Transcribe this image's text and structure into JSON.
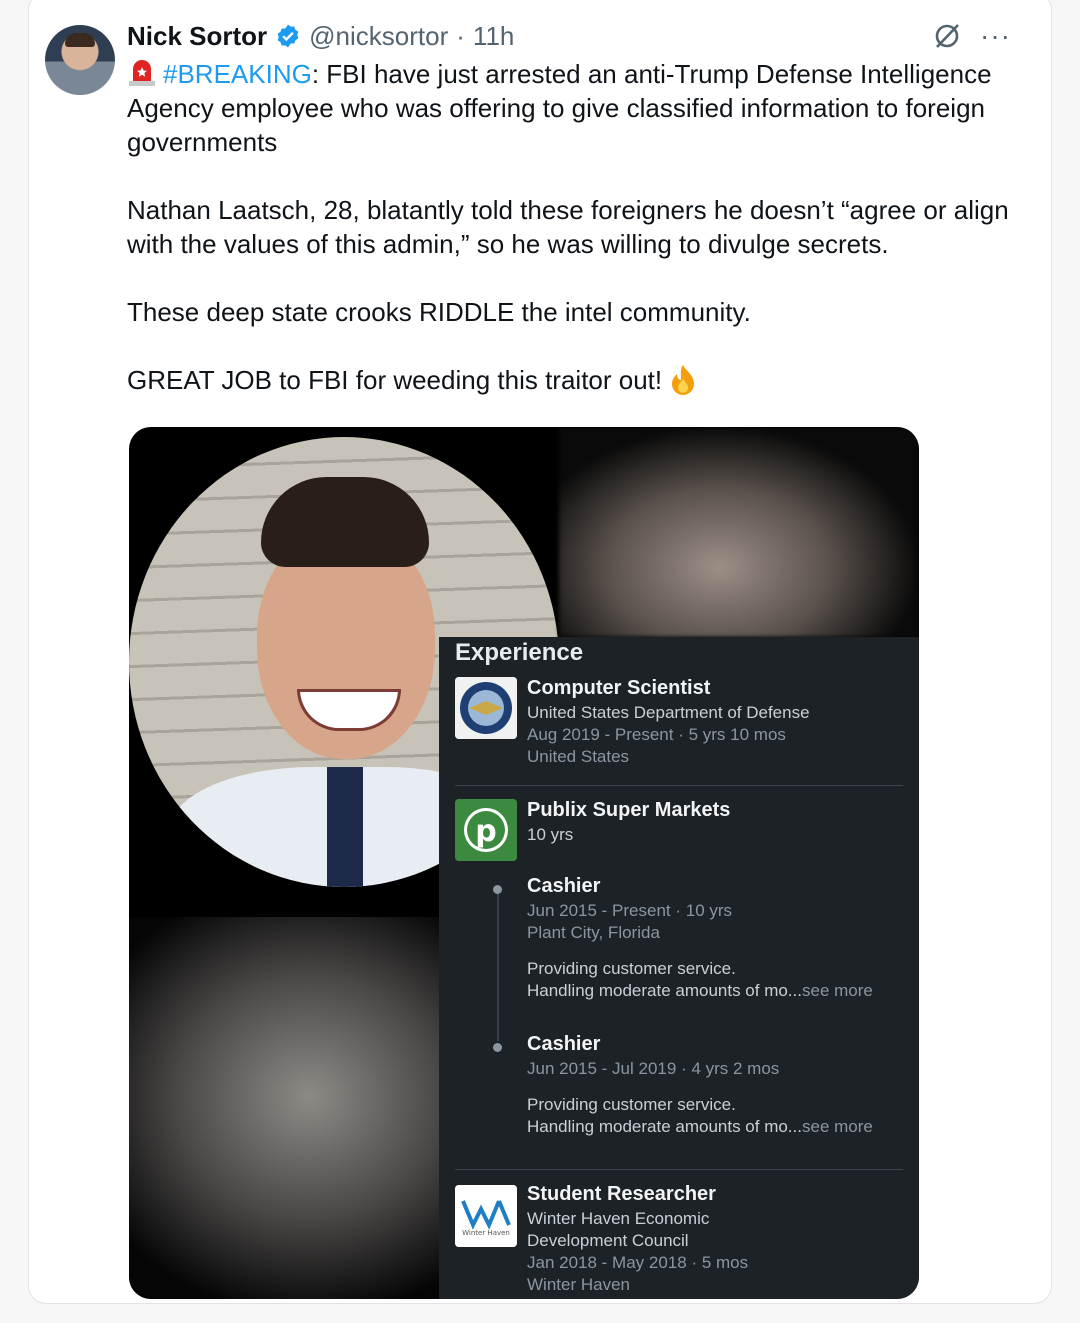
{
  "tweet": {
    "author_name": "Nick Sortor",
    "handle": "@nicksortor",
    "separator": "·",
    "time": "11h",
    "hashtag": "#BREAKING",
    "line1_rest": ": FBI have just arrested an anti-Trump Defense Intelligence Agency employee who was offering to give classified information to foreign governments",
    "para2": "Nathan Laatsch, 28, blatantly told these foreigners he doesn’t “agree or align with the values of this admin,” so he was willing to divulge secrets.",
    "para3": "These deep state crooks RIDDLE the intel community.",
    "para4": "GREAT JOB to FBI for weeding this traitor out!",
    "more_label": "···",
    "accent_color": "#1d9bf0"
  },
  "experience": {
    "title": "Experience",
    "entries": [
      {
        "title": "Computer Scientist",
        "org": "United States Department of Defense",
        "dates": "Aug 2019 - Present · 5 yrs 10 mos",
        "location": "United States"
      },
      {
        "title": "Publix Super Markets",
        "duration": "10 yrs",
        "roles": [
          {
            "title": "Cashier",
            "dates": "Jun 2015 - Present · 10 yrs",
            "location": "Plant City, Florida",
            "desc1": "Providing customer service.",
            "desc2": "Handling moderate amounts of mo...",
            "see_more": "see more"
          },
          {
            "title": "Cashier",
            "dates": "Jun 2015 - Jul 2019 · 4 yrs 2 mos",
            "desc1": "Providing customer service.",
            "desc2": "Handling moderate amounts of mo...",
            "see_more": "see more"
          }
        ]
      },
      {
        "title": "Student Researcher",
        "org_line1": "Winter Haven Economic",
        "org_line2": "Development Council",
        "dates": "Jan 2018 - May 2018 · 5 mos",
        "location": "Winter Haven"
      }
    ]
  },
  "logos": {
    "publix_letter": "p",
    "winter_haven_text": "Winter Haven"
  }
}
